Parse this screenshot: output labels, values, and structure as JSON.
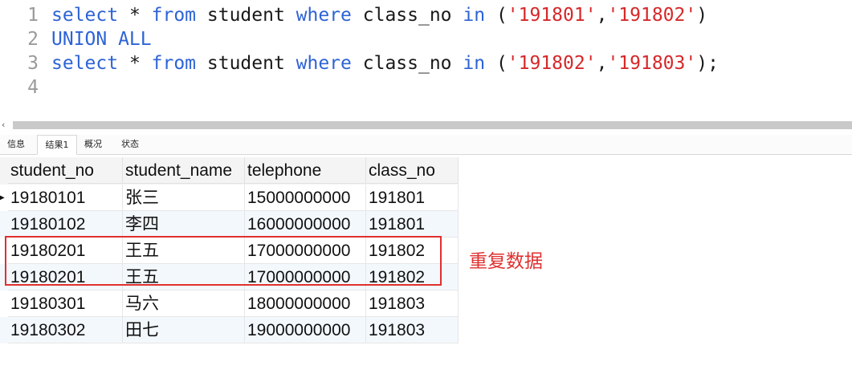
{
  "editor": {
    "lines": [
      {
        "num": "1",
        "tokens": [
          {
            "t": "select",
            "c": "kw"
          },
          {
            "t": " * ",
            "c": "tx"
          },
          {
            "t": "from",
            "c": "kw"
          },
          {
            "t": " student ",
            "c": "tx"
          },
          {
            "t": "where",
            "c": "kw"
          },
          {
            "t": " class_no ",
            "c": "tx"
          },
          {
            "t": "in",
            "c": "kw"
          },
          {
            "t": " (",
            "c": "tx"
          },
          {
            "t": "'191801'",
            "c": "st"
          },
          {
            "t": ",",
            "c": "tx"
          },
          {
            "t": "'191802'",
            "c": "st"
          },
          {
            "t": ")",
            "c": "tx"
          }
        ]
      },
      {
        "num": "2",
        "tokens": [
          {
            "t": "UNION ALL",
            "c": "kw"
          }
        ]
      },
      {
        "num": "3",
        "tokens": [
          {
            "t": "select",
            "c": "kw"
          },
          {
            "t": " * ",
            "c": "tx"
          },
          {
            "t": "from",
            "c": "kw"
          },
          {
            "t": " student ",
            "c": "tx"
          },
          {
            "t": "where",
            "c": "kw"
          },
          {
            "t": " class_no ",
            "c": "tx"
          },
          {
            "t": "in",
            "c": "kw"
          },
          {
            "t": " (",
            "c": "tx"
          },
          {
            "t": "'191802'",
            "c": "st"
          },
          {
            "t": ",",
            "c": "tx"
          },
          {
            "t": "'191803'",
            "c": "st"
          },
          {
            "t": ");",
            "c": "tx"
          }
        ]
      },
      {
        "num": "4",
        "tokens": []
      }
    ]
  },
  "scrollbar": {
    "left_arrow": "‹"
  },
  "tabs": [
    {
      "label": "信息",
      "active": false
    },
    {
      "label": "结果1",
      "active": true
    },
    {
      "label": "概况",
      "active": false
    },
    {
      "label": "状态",
      "active": false
    }
  ],
  "grid": {
    "columns": [
      "student_no",
      "student_name",
      "telephone",
      "class_no"
    ],
    "rows": [
      [
        "19180101",
        "张三",
        "15000000000",
        "191801"
      ],
      [
        "19180102",
        "李四",
        "16000000000",
        "191801"
      ],
      [
        "19180201",
        "王五",
        "17000000000",
        "191802"
      ],
      [
        "19180201",
        "王五",
        "17000000000",
        "191802"
      ],
      [
        "19180301",
        "马六",
        "18000000000",
        "191803"
      ],
      [
        "19180302",
        "田七",
        "19000000000",
        "191803"
      ]
    ],
    "current_row_marker": "▶"
  },
  "annotation": {
    "text": "重复数据",
    "color": "#e03030"
  },
  "colors": {
    "keyword": "#2d63d6",
    "string": "#d6282a",
    "line_number": "#9a9a9a",
    "alt_row": "#f3f8fd"
  }
}
